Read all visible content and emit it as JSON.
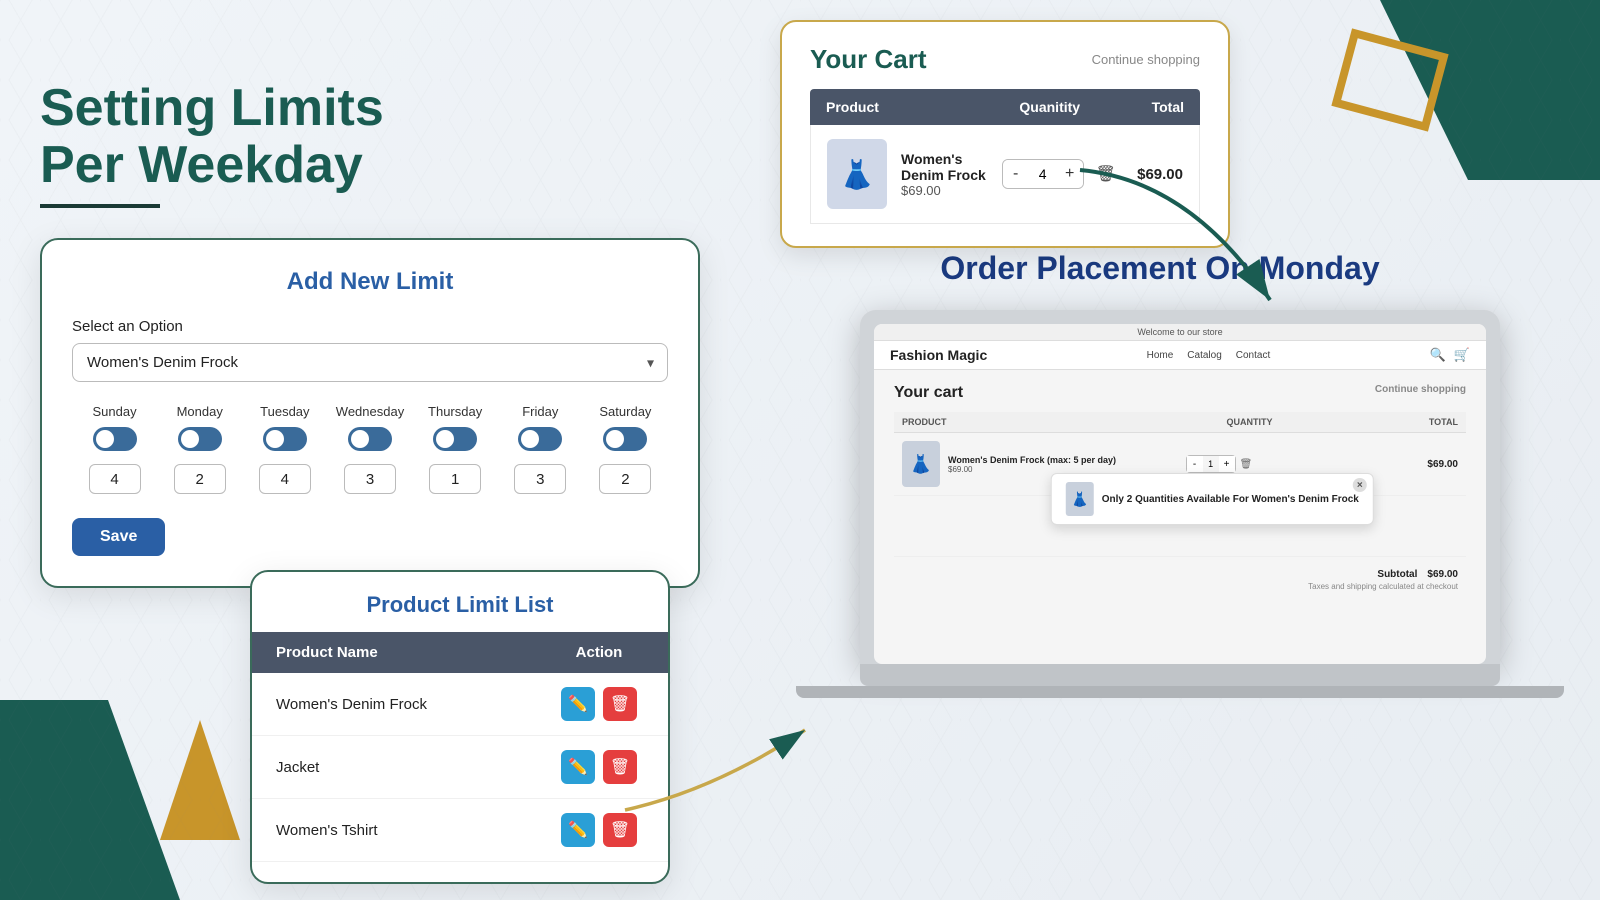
{
  "page": {
    "bg_color": "#eef2f5"
  },
  "left": {
    "main_title_line1": "Setting Limits",
    "main_title_line2": "Per Weekday"
  },
  "add_limit_card": {
    "title": "Add New Limit",
    "select_label": "Select an Option",
    "select_value": "Women's Denim Frock",
    "days": [
      {
        "label": "Sunday",
        "value": "4"
      },
      {
        "label": "Monday",
        "value": "2"
      },
      {
        "label": "Tuesday",
        "value": "4"
      },
      {
        "label": "Wednesday",
        "value": "3"
      },
      {
        "label": "Thursday",
        "value": "1"
      },
      {
        "label": "Friday",
        "value": "3"
      },
      {
        "label": "Saturday",
        "value": "2"
      }
    ],
    "save_label": "Save"
  },
  "product_limit_list": {
    "title": "Product Limit List",
    "col_name": "Product Name",
    "col_action": "Action",
    "items": [
      {
        "name": "Women's Denim Frock"
      },
      {
        "name": "Jacket"
      },
      {
        "name": "Women's Tshirt"
      }
    ]
  },
  "cart_card": {
    "title": "Your Cart",
    "continue_shopping": "Continue shopping",
    "col_product": "Product",
    "col_quantity": "Quanitity",
    "col_total": "Total",
    "item": {
      "name": "Women's Denim Frock",
      "price": "$69.00",
      "quantity": "4",
      "total": "$69.00"
    }
  },
  "order_section": {
    "title": "Order Placement On Monday",
    "store_top": "Welcome to our store",
    "brand": "Fashion Magic",
    "nav_links": [
      "Home",
      "Catalog",
      "Contact"
    ],
    "cart_title": "Your cart",
    "continue_shopping": "Continue shopping",
    "col_product": "PRODUCT",
    "col_quantity": "QUANTITY",
    "col_total": "TOTAL",
    "item": {
      "name": "Women's Denim Frock (max: 5 per day)",
      "price": "$69.00",
      "quantity": "1",
      "total": "$69.00"
    },
    "tooltip": "Only 2 Quantities Available For Women's Denim Frock",
    "subtotal_label": "Subtotal",
    "subtotal_value": "$69.00",
    "taxes_note": "Taxes and shipping calculated at checkout"
  }
}
